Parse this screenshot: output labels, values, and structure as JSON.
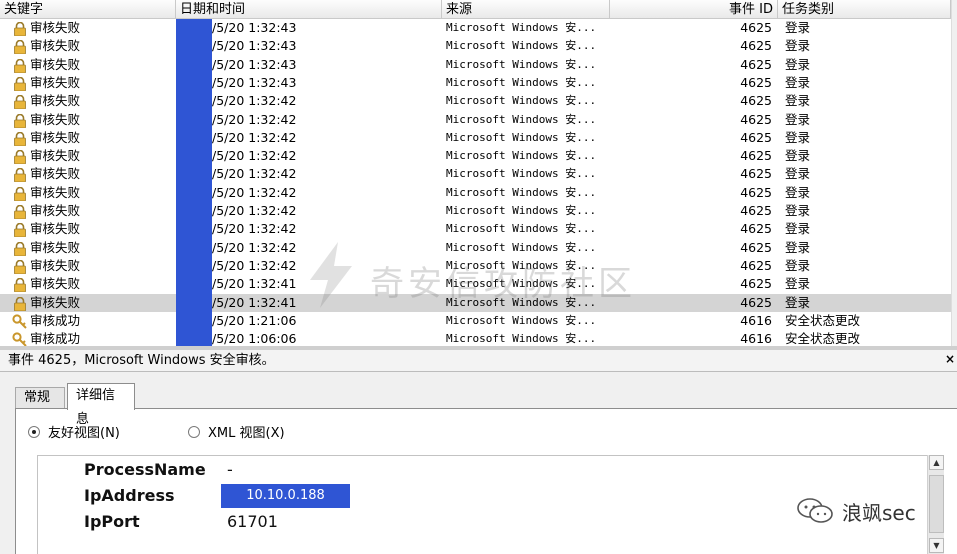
{
  "list": {
    "columns": {
      "keyword": "关键字",
      "datetime": "日期和时间",
      "source": "来源",
      "event_id": "事件 ID",
      "task_category": "任务类别"
    },
    "rows": [
      {
        "icon": "lock",
        "keyword": "审核失败",
        "datetime": "/5/20 1:32:43",
        "source": "Microsoft Windows 安...",
        "event_id": "4625",
        "task_category": "登录"
      },
      {
        "icon": "lock",
        "keyword": "审核失败",
        "datetime": "/5/20 1:32:43",
        "source": "Microsoft Windows 安...",
        "event_id": "4625",
        "task_category": "登录"
      },
      {
        "icon": "lock",
        "keyword": "审核失败",
        "datetime": "/5/20 1:32:43",
        "source": "Microsoft Windows 安...",
        "event_id": "4625",
        "task_category": "登录"
      },
      {
        "icon": "lock",
        "keyword": "审核失败",
        "datetime": "/5/20 1:32:43",
        "source": "Microsoft Windows 安...",
        "event_id": "4625",
        "task_category": "登录"
      },
      {
        "icon": "lock",
        "keyword": "审核失败",
        "datetime": "/5/20 1:32:42",
        "source": "Microsoft Windows 安...",
        "event_id": "4625",
        "task_category": "登录"
      },
      {
        "icon": "lock",
        "keyword": "审核失败",
        "datetime": "/5/20 1:32:42",
        "source": "Microsoft Windows 安...",
        "event_id": "4625",
        "task_category": "登录"
      },
      {
        "icon": "lock",
        "keyword": "审核失败",
        "datetime": "/5/20 1:32:42",
        "source": "Microsoft Windows 安...",
        "event_id": "4625",
        "task_category": "登录"
      },
      {
        "icon": "lock",
        "keyword": "审核失败",
        "datetime": "/5/20 1:32:42",
        "source": "Microsoft Windows 安...",
        "event_id": "4625",
        "task_category": "登录"
      },
      {
        "icon": "lock",
        "keyword": "审核失败",
        "datetime": "/5/20 1:32:42",
        "source": "Microsoft Windows 安...",
        "event_id": "4625",
        "task_category": "登录"
      },
      {
        "icon": "lock",
        "keyword": "审核失败",
        "datetime": "/5/20 1:32:42",
        "source": "Microsoft Windows 安...",
        "event_id": "4625",
        "task_category": "登录"
      },
      {
        "icon": "lock",
        "keyword": "审核失败",
        "datetime": "/5/20 1:32:42",
        "source": "Microsoft Windows 安...",
        "event_id": "4625",
        "task_category": "登录"
      },
      {
        "icon": "lock",
        "keyword": "审核失败",
        "datetime": "/5/20 1:32:42",
        "source": "Microsoft Windows 安...",
        "event_id": "4625",
        "task_category": "登录"
      },
      {
        "icon": "lock",
        "keyword": "审核失败",
        "datetime": "/5/20 1:32:42",
        "source": "Microsoft Windows 安...",
        "event_id": "4625",
        "task_category": "登录"
      },
      {
        "icon": "lock",
        "keyword": "审核失败",
        "datetime": "/5/20 1:32:42",
        "source": "Microsoft Windows 安...",
        "event_id": "4625",
        "task_category": "登录"
      },
      {
        "icon": "lock",
        "keyword": "审核失败",
        "datetime": "/5/20 1:32:41",
        "source": "Microsoft Windows 安...",
        "event_id": "4625",
        "task_category": "登录"
      },
      {
        "icon": "lock",
        "keyword": "审核失败",
        "datetime": "/5/20 1:32:41",
        "source": "Microsoft Windows 安...",
        "event_id": "4625",
        "task_category": "登录",
        "selected": true
      },
      {
        "icon": "key",
        "keyword": "审核成功",
        "datetime": "/5/20 1:21:06",
        "source": "Microsoft Windows 安...",
        "event_id": "4616",
        "task_category": "安全状态更改"
      },
      {
        "icon": "key",
        "keyword": "审核成功",
        "datetime": "/5/20 1:06:06",
        "source": "Microsoft Windows 安...",
        "event_id": "4616",
        "task_category": "安全状态更改"
      }
    ]
  },
  "watermark": "奇安信攻防社区",
  "detail": {
    "title": "事件 4625，Microsoft Windows 安全审核。",
    "close": "×",
    "tabs": [
      "常规",
      "详细信息"
    ],
    "active_tab": "详细信息",
    "views": {
      "friendly": "友好视图(N)",
      "xml": "XML 视图(X)",
      "selected": "friendly"
    },
    "fields": [
      {
        "key": "ProcessName",
        "value": "-"
      },
      {
        "key": "IpAddress",
        "value": "10.10.0.188"
      },
      {
        "key": "IpPort",
        "value": "61701"
      }
    ]
  },
  "badge": "浪飒sec",
  "colors": {
    "redaction": "#2f55d4",
    "selected_row": "#d4d4d4"
  }
}
